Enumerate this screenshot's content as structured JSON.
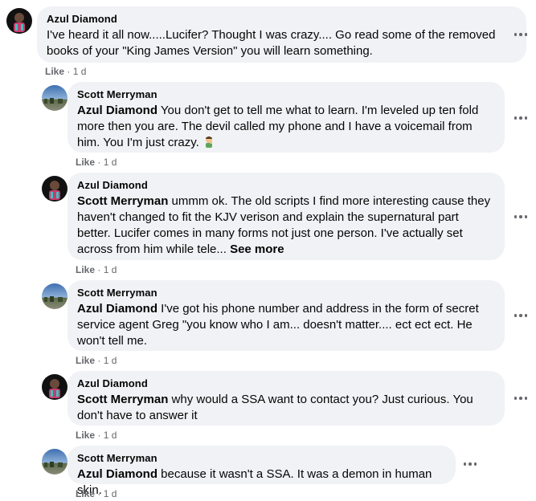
{
  "comments": [
    {
      "author": "Azul Diamond",
      "mention": "",
      "text": "I've heard it all now.....Lucifer? Thought I was crazy.... Go read some of the removed books of your \"King James Version\" you will learn something.",
      "like_label": "Like",
      "separator": "·",
      "time": "1 d"
    },
    {
      "author": "Scott Merryman",
      "mention": "Azul Diamond",
      "text": "You don't get to tell me what to learn. I'm leveled up ten fold more then you are. The devil called my phone and I have a voicemail from him. You I'm just crazy.",
      "emoji": "person-facepalming-emoji",
      "like_label": "Like",
      "separator": "·",
      "time": "1 d"
    },
    {
      "author": "Azul Diamond",
      "mention": "Scott Merryman",
      "text": "ummm ok. The old scripts I find more interesting cause they haven't changed to fit the KJV verison and explain the supernatural part better. Lucifer comes in many forms not just one person. I've actually set across from him while tele...",
      "see_more": "See more",
      "like_label": "Like",
      "separator": "·",
      "time": "1 d"
    },
    {
      "author": "Scott Merryman",
      "mention": "Azul Diamond",
      "text": "I've got his phone number and address in the form of secret service agent Greg \"you know who I am... doesn't matter.... ect ect ect. He won't tell me.",
      "like_label": "Like",
      "separator": "·",
      "time": "1 d"
    },
    {
      "author": "Azul Diamond",
      "mention": "Scott Merryman",
      "text": "why would a SSA want to contact you? Just curious. You don't have to answer it",
      "like_label": "Like",
      "separator": "·",
      "time": "1 d"
    },
    {
      "author": "Scott Merryman",
      "mention": "Azul Diamond",
      "text": "because it wasn't a SSA. It was a demon in human skin.",
      "like_label": "Like",
      "separator": "·",
      "time": "1 d"
    }
  ],
  "icons": {
    "more": "more-options-icon",
    "avatar_azul": "azul-diamond-avatar",
    "avatar_scott": "scott-merryman-avatar"
  },
  "colors": {
    "bubble": "#f0f2f5",
    "meta": "#65676b",
    "text": "#050505"
  }
}
